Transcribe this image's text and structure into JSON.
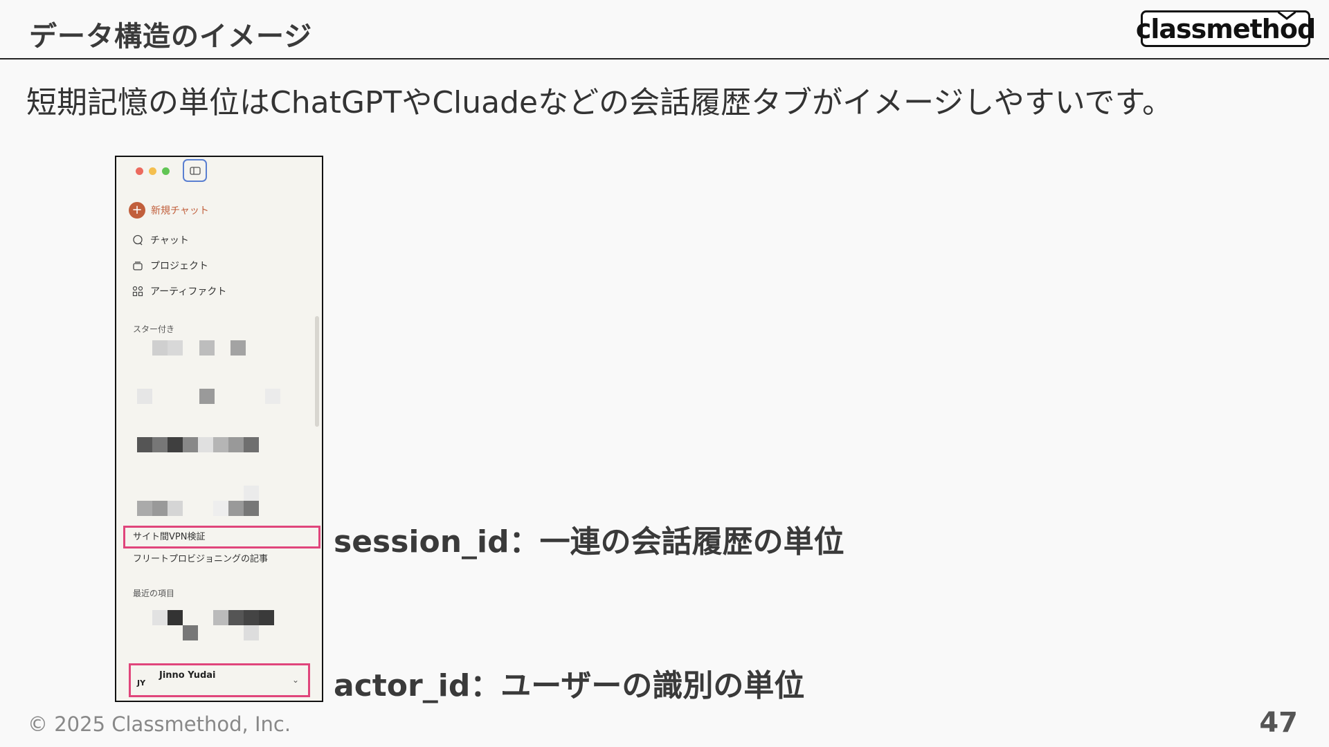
{
  "header": {
    "title": "データ構造のイメージ",
    "logo_text": "classmethod"
  },
  "subtitle": "短期記憶の単位はChatGPTやCluadeなどの会話履歴タブがイメージしやすいです。",
  "screenshot": {
    "new_chat": "新規チャット",
    "nav": {
      "chat": "チャット",
      "projects": "プロジェクト",
      "artifacts": "アーティファクト"
    },
    "starred_label": "スター付き",
    "starred_items": [
      "サイト間VPN検証",
      "フリートプロビジョニングの記事"
    ],
    "recent_label": "最近の項目",
    "user": {
      "initials": "JY",
      "name": "Jinno Yudai"
    }
  },
  "annotations": {
    "session": "session_id：一連の会話履歴の単位",
    "actor": "actor_id：ユーザーの識別の単位"
  },
  "footer": {
    "copyright": "© 2025 Classmethod, Inc.",
    "page_number": "47"
  },
  "colors": {
    "accent": "#c15f3c",
    "highlight": "#e0457b",
    "traffic_red": "#ec6a5e",
    "traffic_yellow": "#f4bf4f",
    "traffic_green": "#61c554"
  }
}
